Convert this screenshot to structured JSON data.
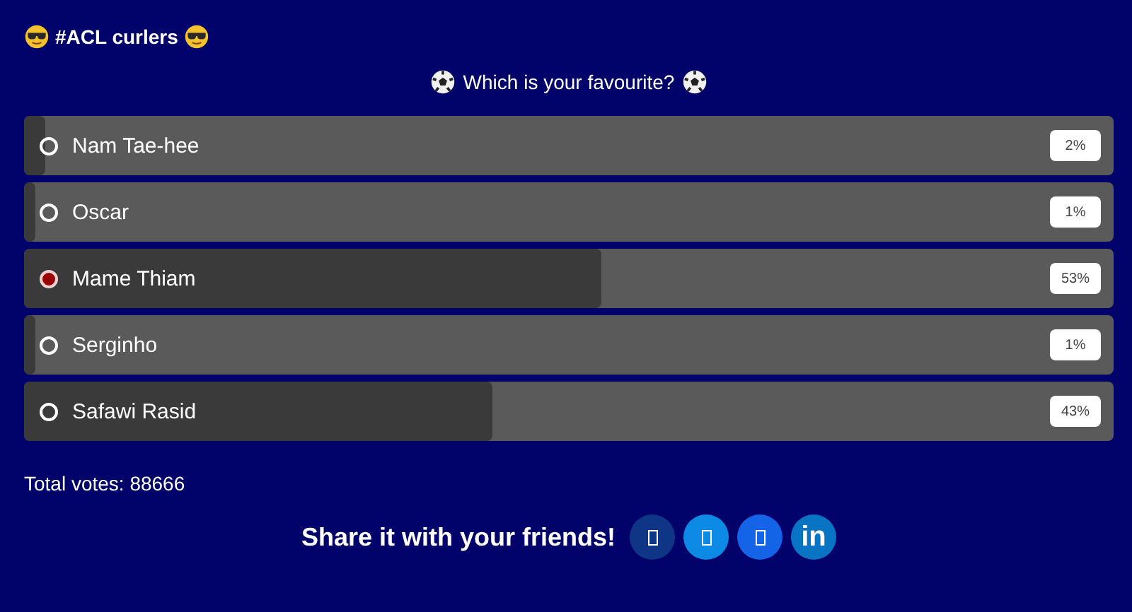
{
  "title": "#ACL curlers",
  "question": "Which is your favourite?",
  "options": [
    {
      "name": "Nam Tae-hee",
      "selected": false,
      "level": 0.02,
      "percent": "2%"
    },
    {
      "name": "Oscar",
      "selected": false,
      "level": 0.01,
      "percent": "1%"
    },
    {
      "name": "Mame Thiam",
      "selected": true,
      "level": 0.53,
      "percent": "53%"
    },
    {
      "name": "Serginho",
      "selected": false,
      "level": 0.01,
      "percent": "1%"
    },
    {
      "name": "Safawi Rasid",
      "selected": false,
      "level": 0.43,
      "percent": "43%"
    }
  ],
  "total_votes": "Total votes: 88666",
  "share": {
    "label": "Share it with your friends!",
    "buttons": [
      {
        "kind": "glyph",
        "color": "#0e3586"
      },
      {
        "kind": "glyph",
        "color": "#0d8ae6"
      },
      {
        "kind": "glyph",
        "color": "#1564e8"
      },
      {
        "kind": "text",
        "text": "in",
        "color": "#0a74c4"
      }
    ]
  }
}
